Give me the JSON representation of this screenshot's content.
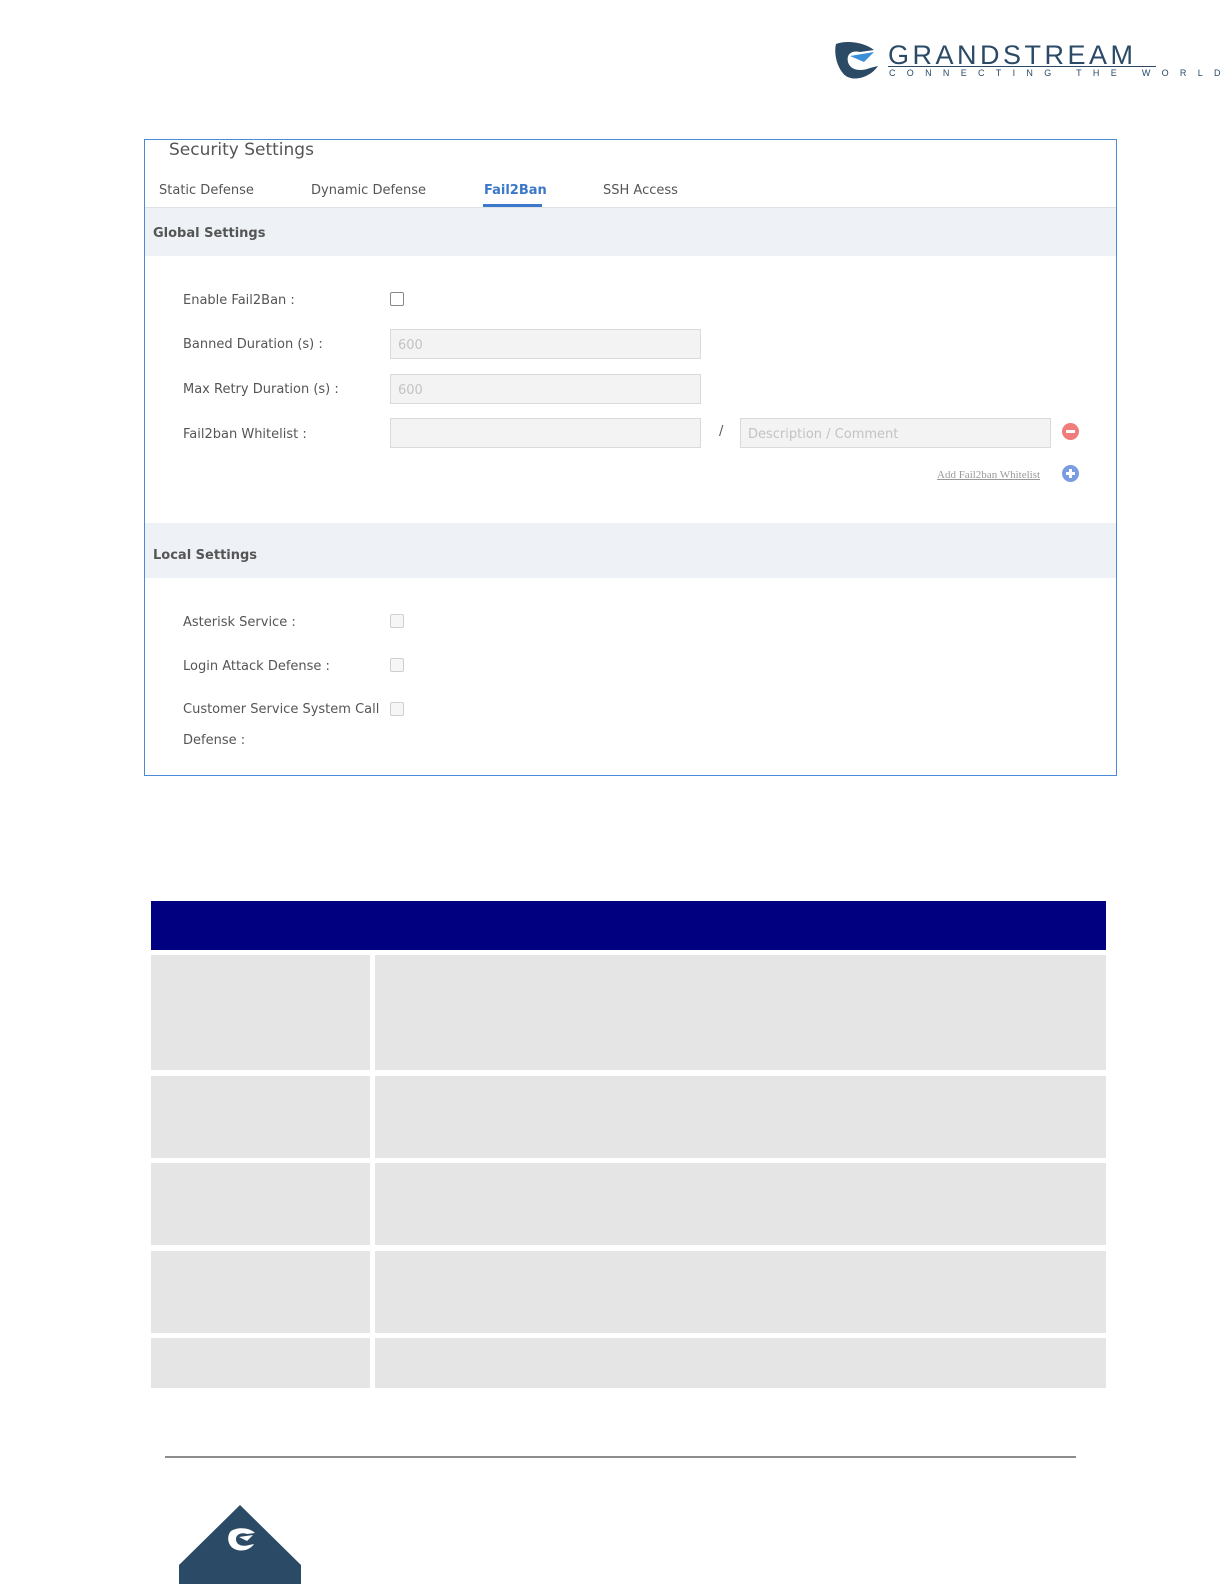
{
  "brand": {
    "name": "GRANDSTREAM",
    "tagline": "CONNECTING THE WORLD",
    "logo_icon": "grandstream-logo-icon",
    "colors": {
      "brand_dark": "#2a4a66",
      "accent": "#3b78c9",
      "table_header": "#000080"
    }
  },
  "panel": {
    "title": "Security Settings",
    "tabs": [
      {
        "label": "Static Defense"
      },
      {
        "label": "Dynamic Defense"
      },
      {
        "label": "Fail2Ban",
        "active": true
      },
      {
        "label": "SSH Access"
      }
    ],
    "global": {
      "heading": "Global Settings",
      "enable_label": "Enable Fail2Ban :",
      "enable_checked": false,
      "banned_label": "Banned Duration (s) :",
      "banned_value": "600",
      "retry_label": "Max Retry Duration (s) :",
      "retry_value": "600",
      "whitelist_label": "Fail2ban Whitelist :",
      "whitelist_value": "",
      "separator": "/",
      "description_placeholder": "Description / Comment",
      "remove_icon": "minus-circle-icon",
      "add_link": "Add Fail2ban Whitelist",
      "add_icon": "plus-circle-icon"
    },
    "local": {
      "heading": "Local Settings",
      "asterisk_label": "Asterisk Service :",
      "login_label": "Login Attack Defense :",
      "customer_label_line1": "Customer Service System Call",
      "customer_label_line2": "Defense :"
    }
  },
  "footer": {
    "logo_icon": "grandstream-footer-logo-icon"
  }
}
